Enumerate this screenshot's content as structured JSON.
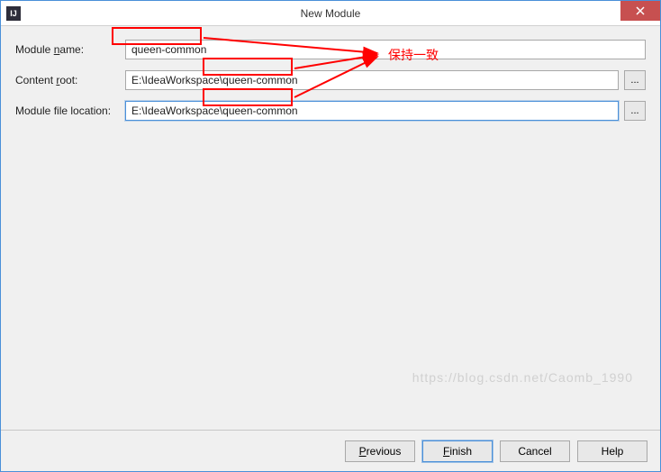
{
  "window": {
    "title": "New Module",
    "icon_letter": "IJ"
  },
  "form": {
    "module_name": {
      "label_pre": "Module ",
      "label_u": "n",
      "label_post": "ame:",
      "value": "queen-common"
    },
    "content_root": {
      "label_pre": "Content ",
      "label_u": "r",
      "label_post": "oot:",
      "value": "E:\\IdeaWorkspace\\queen-common",
      "browse": "..."
    },
    "module_file_location": {
      "label": "Module file location:",
      "value": "E:\\IdeaWorkspace\\queen-common",
      "browse": "..."
    }
  },
  "buttons": {
    "previous_u": "P",
    "previous_post": "revious",
    "finish_u": "F",
    "finish_post": "inish",
    "cancel": "Cancel",
    "help": "Help"
  },
  "annotation": {
    "text": "保持一致"
  },
  "watermark": "https://blog.csdn.net/Caomb_1990"
}
